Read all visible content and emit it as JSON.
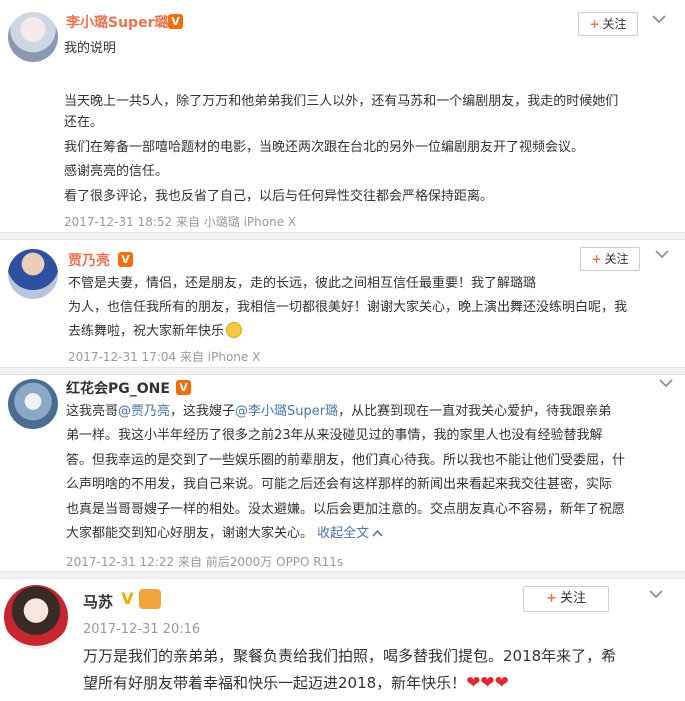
{
  "posts": [
    {
      "author": "李小璐Super璐",
      "verified": "V",
      "follow_label": "关注",
      "lines": [
        "我的说明",
        "当天晚上一共5人，除了万万和他弟弟我们三人以外，还有马苏和一个编剧朋友，我走的时候她们",
        "还在。",
        "我们在筹备一部嘻哈题材的电影，当晚还两次跟在台北的另外一位编剧朋友开了视频会议。",
        "感谢亮亮的信任。",
        "看了很多评论，我也反省了自己，以后与任何异性交往都会严格保持距离。"
      ],
      "meta": "2017-12-31 18:52 来自 小璐璐 iPhone X"
    },
    {
      "author": "贾乃亮",
      "verified": "V",
      "follow_label": "关注",
      "lines": [
        "不管是夫妻，情侣，还是朋友，走的长远，彼此之间相互信任最重要！我了解璐璐",
        "为人，也信任我所有的朋友，我相信一切都很美好！谢谢大家关心，晚上演出舞还没练明白呢，我",
        "去练舞啦，祝大家新年快乐"
      ],
      "meta": "2017-12-31 17:04 来自 iPhone X"
    },
    {
      "author": "红花会PG_ONE",
      "verified": "V",
      "mention1": "@贾乃亮",
      "mention2": "@李小璐Super璐",
      "line1_a": "这我亮哥",
      "line1_b": "，这我嫂子",
      "line1_c": "，从比赛到现在一直对我关心爱护，待我跟亲弟",
      "lines": [
        "弟一样。我这小半年经历了很多之前23年从来没碰见过的事情，我的家里人也没有经验替我解",
        "答。但我幸运的是交到了一些娱乐圈的前辈朋友，他们真心待我。所以我也不能让他们受委屈，什",
        "么声明啥的不用发，我自己来说。可能之后还会有这样那样的新闻出来看起来我交往甚密，实际",
        "也真是当哥哥嫂子一样的相处。没太避嫌。以后会更加注意的。交点朋友真心不容易，新年了祝愿"
      ],
      "last_line": "大家都能交到知心好朋友，谢谢大家关心。",
      "collapse_label": "收起全文",
      "meta": "2017-12-31 12:22 来自 前后2000万 OPPO R11s"
    },
    {
      "author": "马苏",
      "verified": "V",
      "follow_label": "关注",
      "date": "2017-12-31 20:16",
      "lines": [
        "万万是我们的亲弟弟，聚餐负责给我们拍照，喝多替我们提包。2018年来了，希",
        "望所有好朋友带着幸福和快乐一起迈进2018，新年快乐！"
      ],
      "hearts": "❤❤❤"
    }
  ],
  "colors": {
    "accent": "#eb7350",
    "link": "#4a74a8",
    "meta": "#999999"
  }
}
